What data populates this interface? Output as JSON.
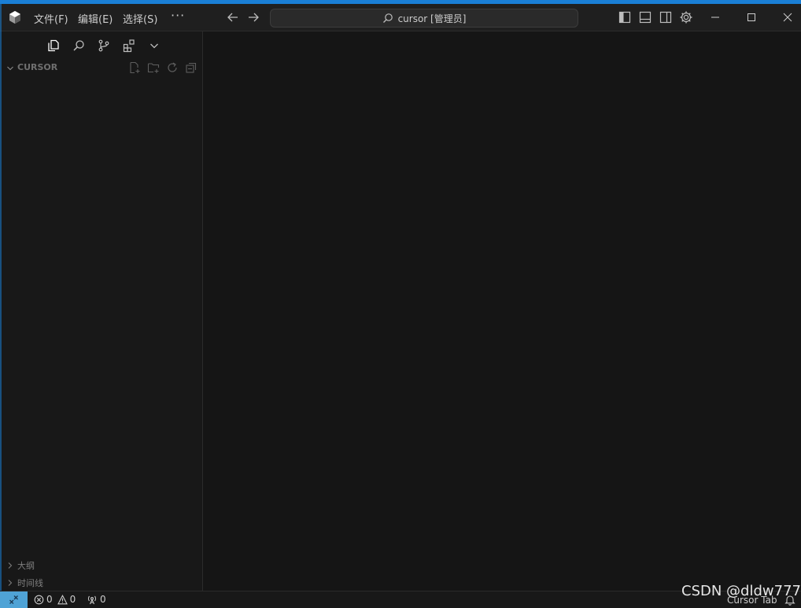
{
  "titlebar": {
    "menus": [
      "文件(F)",
      "编辑(E)",
      "选择(S)"
    ],
    "more": "···",
    "command_center": "cursor [管理员]"
  },
  "sidebar": {
    "explorer_title": "CURSOR",
    "outline_title": "大纲",
    "timeline_title": "时间线"
  },
  "statusbar": {
    "errors": "0",
    "warnings": "0",
    "ports": "0",
    "right_label": "Cursor Tab"
  },
  "watermark": "CSDN @dldw777",
  "colors": {
    "accent": "#1a7fd6",
    "remote": "#4fa3d6",
    "editor_bg": "#151515"
  },
  "icons": [
    "app-logo-icon",
    "arrow-left-icon",
    "arrow-right-icon",
    "search-icon",
    "toggle-primary-sidebar-icon",
    "toggle-panel-icon",
    "toggle-secondary-sidebar-icon",
    "gear-icon",
    "minimize-icon",
    "maximize-icon",
    "close-icon",
    "explorer-icon",
    "search-icon",
    "source-control-icon",
    "extensions-icon",
    "chevron-down-icon",
    "new-file-icon",
    "new-folder-icon",
    "refresh-icon",
    "collapse-all-icon",
    "chevron-right-icon",
    "remote-icon",
    "error-icon",
    "warning-icon",
    "ports-icon",
    "bell-icon"
  ]
}
